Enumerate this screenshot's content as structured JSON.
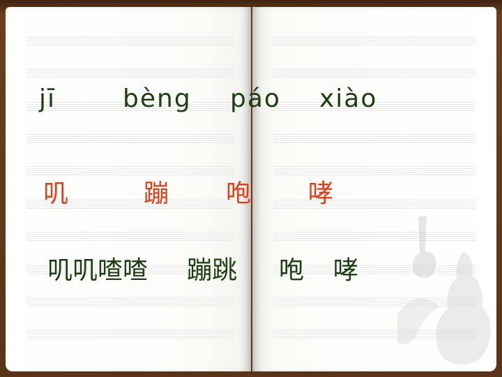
{
  "pinyin": [
    "jī",
    "bèng",
    "páo",
    "xiào"
  ],
  "characters": [
    "叽",
    "蹦",
    "咆",
    "哮"
  ],
  "words": [
    "叽叽喳喳",
    "蹦跳",
    "咆",
    "哮"
  ],
  "colors": {
    "pinyin": "#1d3e12",
    "characters": "#e0401a",
    "words": "#1d3e12",
    "frame": "#5a3418"
  },
  "decoration_icon": "violin-icon"
}
